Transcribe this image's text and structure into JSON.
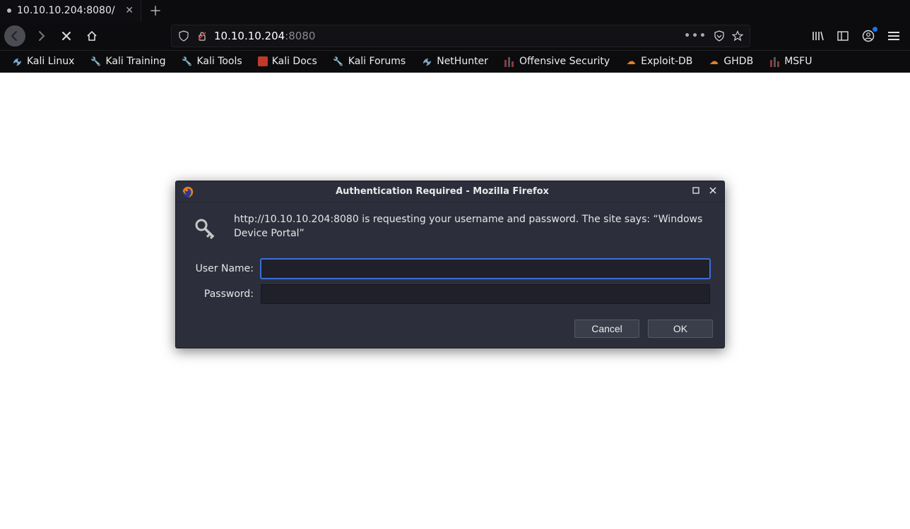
{
  "tab": {
    "title": "10.10.10.204:8080/"
  },
  "url": {
    "host": "10.10.10.204",
    "port": ":8080"
  },
  "bookmarks": [
    {
      "label": "Kali Linux",
      "icon": "dragon"
    },
    {
      "label": "Kali Training",
      "icon": "tool"
    },
    {
      "label": "Kali Tools",
      "icon": "tool"
    },
    {
      "label": "Kali Docs",
      "icon": "red"
    },
    {
      "label": "Kali Forums",
      "icon": "tool"
    },
    {
      "label": "NetHunter",
      "icon": "dragon"
    },
    {
      "label": "Offensive Security",
      "icon": "bars"
    },
    {
      "label": "Exploit-DB",
      "icon": "orange"
    },
    {
      "label": "GHDB",
      "icon": "orange"
    },
    {
      "label": "MSFU",
      "icon": "bars"
    }
  ],
  "dialog": {
    "title": "Authentication Required - Mozilla Firefox",
    "message": "http://10.10.10.204:8080 is requesting your username and password. The site says: “Windows Device Portal”",
    "username_label": "User Name:",
    "password_label": "Password:",
    "username_value": "",
    "password_value": "",
    "cancel_label": "Cancel",
    "ok_label": "OK"
  }
}
